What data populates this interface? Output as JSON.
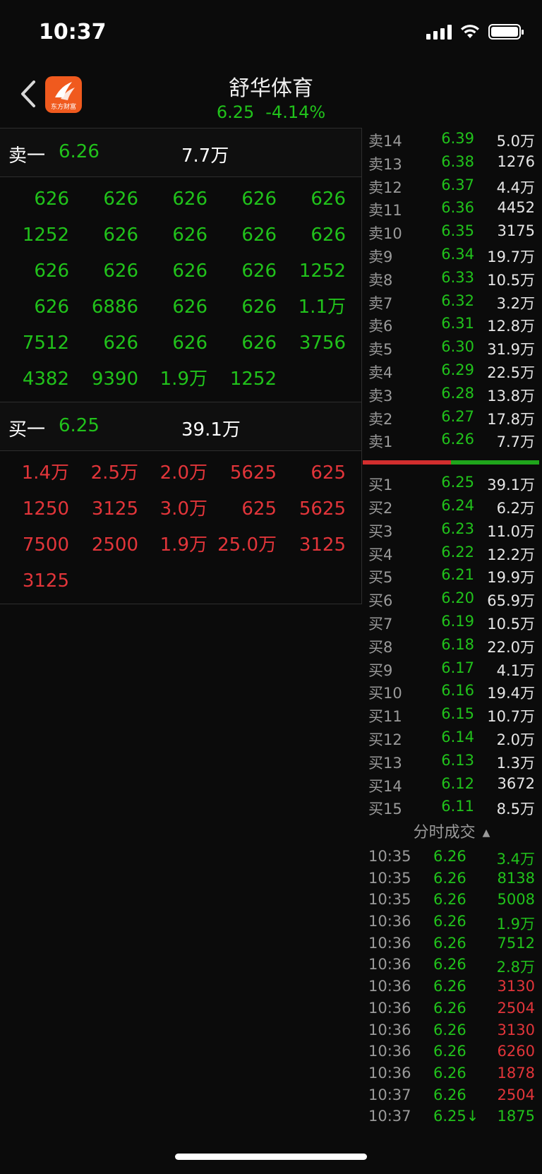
{
  "status_bar": {
    "time": "10:37"
  },
  "header": {
    "stock_name": "舒华体育",
    "price": "6.25",
    "change_pct": "-4.14%",
    "logo_text": "东方财富"
  },
  "sell_one": {
    "label": "卖一",
    "price": "6.26",
    "volume": "7.7万"
  },
  "sell_orders": [
    "626",
    "626",
    "626",
    "626",
    "626",
    "1252",
    "626",
    "626",
    "626",
    "626",
    "626",
    "626",
    "626",
    "626",
    "1252",
    "626",
    "6886",
    "626",
    "626",
    "1.1万",
    "7512",
    "626",
    "626",
    "626",
    "3756",
    "4382",
    "9390",
    "1.9万",
    "1252",
    ""
  ],
  "buy_one": {
    "label": "买一",
    "price": "6.25",
    "volume": "39.1万"
  },
  "buy_orders": [
    "1.4万",
    "2.5万",
    "2.0万",
    "5625",
    "625",
    "1250",
    "3125",
    "3.0万",
    "625",
    "5625",
    "7500",
    "2500",
    "1.9万",
    "25.0万",
    "3125",
    "3125",
    "",
    "",
    "",
    ""
  ],
  "order_book": {
    "asks": [
      {
        "label": "卖14",
        "price": "6.39",
        "volume": "5.0万"
      },
      {
        "label": "卖13",
        "price": "6.38",
        "volume": "1276"
      },
      {
        "label": "卖12",
        "price": "6.37",
        "volume": "4.4万"
      },
      {
        "label": "卖11",
        "price": "6.36",
        "volume": "4452"
      },
      {
        "label": "卖10",
        "price": "6.35",
        "volume": "3175"
      },
      {
        "label": "卖9",
        "price": "6.34",
        "volume": "19.7万"
      },
      {
        "label": "卖8",
        "price": "6.33",
        "volume": "10.5万"
      },
      {
        "label": "卖7",
        "price": "6.32",
        "volume": "3.2万"
      },
      {
        "label": "卖6",
        "price": "6.31",
        "volume": "12.8万"
      },
      {
        "label": "卖5",
        "price": "6.30",
        "volume": "31.9万"
      },
      {
        "label": "卖4",
        "price": "6.29",
        "volume": "22.5万"
      },
      {
        "label": "卖3",
        "price": "6.28",
        "volume": "13.8万"
      },
      {
        "label": "卖2",
        "price": "6.27",
        "volume": "17.8万"
      },
      {
        "label": "卖1",
        "price": "6.26",
        "volume": "7.7万"
      }
    ],
    "bids": [
      {
        "label": "买1",
        "price": "6.25",
        "volume": "39.1万"
      },
      {
        "label": "买2",
        "price": "6.24",
        "volume": "6.2万"
      },
      {
        "label": "买3",
        "price": "6.23",
        "volume": "11.0万"
      },
      {
        "label": "买4",
        "price": "6.22",
        "volume": "12.2万"
      },
      {
        "label": "买5",
        "price": "6.21",
        "volume": "19.9万"
      },
      {
        "label": "买6",
        "price": "6.20",
        "volume": "65.9万"
      },
      {
        "label": "买7",
        "price": "6.19",
        "volume": "10.5万"
      },
      {
        "label": "买8",
        "price": "6.18",
        "volume": "22.0万"
      },
      {
        "label": "买9",
        "price": "6.17",
        "volume": "4.1万"
      },
      {
        "label": "买10",
        "price": "6.16",
        "volume": "19.4万"
      },
      {
        "label": "买11",
        "price": "6.15",
        "volume": "10.7万"
      },
      {
        "label": "买12",
        "price": "6.14",
        "volume": "2.0万"
      },
      {
        "label": "买13",
        "price": "6.13",
        "volume": "1.3万"
      },
      {
        "label": "买14",
        "price": "6.12",
        "volume": "3672"
      },
      {
        "label": "买15",
        "price": "6.11",
        "volume": "8.5万"
      }
    ]
  },
  "ticks": {
    "title": "分时成交",
    "rows": [
      {
        "time": "10:35",
        "price": "6.26",
        "volume": "3.4万",
        "color": "green"
      },
      {
        "time": "10:35",
        "price": "6.26",
        "volume": "8138",
        "color": "green"
      },
      {
        "time": "10:35",
        "price": "6.26",
        "volume": "5008",
        "color": "green"
      },
      {
        "time": "10:36",
        "price": "6.26",
        "volume": "1.9万",
        "color": "green"
      },
      {
        "time": "10:36",
        "price": "6.26",
        "volume": "7512",
        "color": "green"
      },
      {
        "time": "10:36",
        "price": "6.26",
        "volume": "2.8万",
        "color": "green"
      },
      {
        "time": "10:36",
        "price": "6.26",
        "volume": "3130",
        "color": "red"
      },
      {
        "time": "10:36",
        "price": "6.26",
        "volume": "2504",
        "color": "red"
      },
      {
        "time": "10:36",
        "price": "6.26",
        "volume": "3130",
        "color": "red"
      },
      {
        "time": "10:36",
        "price": "6.26",
        "volume": "6260",
        "color": "red"
      },
      {
        "time": "10:36",
        "price": "6.26",
        "volume": "1878",
        "color": "red"
      },
      {
        "time": "10:37",
        "price": "6.26",
        "volume": "2504",
        "color": "red"
      },
      {
        "time": "10:37",
        "price": "6.25↓",
        "volume": "1875",
        "color": "green"
      }
    ]
  },
  "colors": {
    "up": "#e2353a",
    "down": "#21c21b",
    "background": "#0b0b0b"
  }
}
